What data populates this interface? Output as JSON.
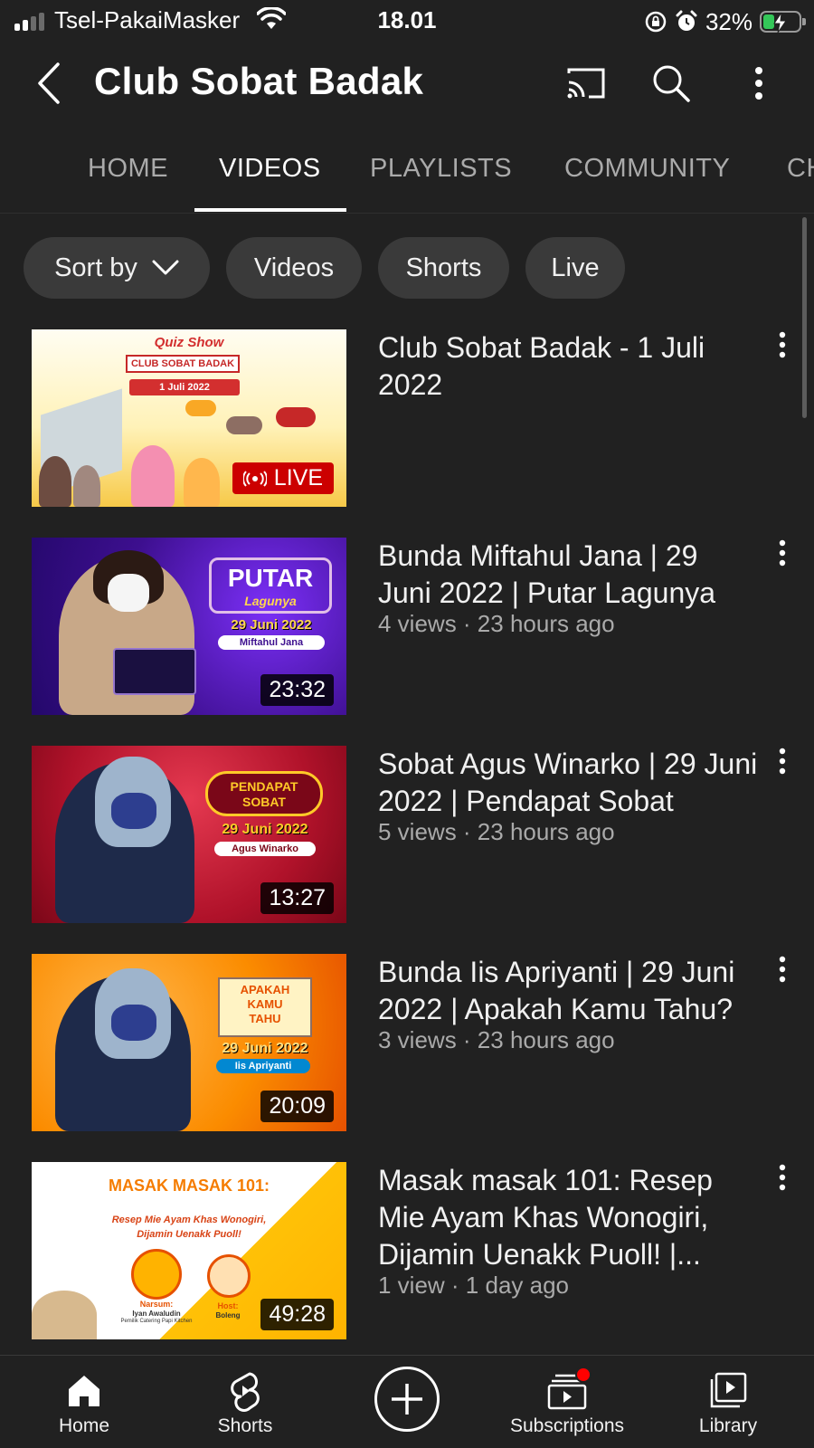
{
  "status_bar": {
    "carrier": "Tsel-PakaiMasker",
    "time": "18.01",
    "battery": "32%",
    "battery_level": 0.32
  },
  "header": {
    "title": "Club Sobat Badak",
    "icons": [
      "back-icon",
      "cast-icon",
      "search-icon",
      "more-vertical-icon"
    ]
  },
  "tabs": [
    {
      "label": "HOME",
      "active": false
    },
    {
      "label": "VIDEOS",
      "active": true
    },
    {
      "label": "PLAYLISTS",
      "active": false
    },
    {
      "label": "COMMUNITY",
      "active": false
    },
    {
      "label": "CH",
      "active": false
    }
  ],
  "chips": [
    {
      "label": "Sort by",
      "icon": "chevron-down-icon"
    },
    {
      "label": "Videos"
    },
    {
      "label": "Shorts"
    },
    {
      "label": "Live"
    }
  ],
  "videos": [
    {
      "title": "Club Sobat Badak - 1 Juli 2022",
      "subtitle": "",
      "badge": "LIVE",
      "thumb": {
        "lines": [
          "Quiz Show",
          "CLUB SOBAT BADAK",
          "1 Juli 2022"
        ],
        "theme": "yellow"
      }
    },
    {
      "title": "Bunda Miftahul Jana | 29 Juni 2022 | Putar Lagunya",
      "subtitle": "4 views · 23 hours ago",
      "duration": "23:32",
      "thumb": {
        "lines": [
          "PUTAR",
          "Lagunya",
          "29 Juni 2022",
          "Miftahul Jana"
        ],
        "theme": "purple"
      }
    },
    {
      "title": "Sobat Agus Winarko | 29 Juni 2022 | Pendapat Sobat",
      "subtitle": "5 views · 23 hours ago",
      "duration": "13:27",
      "thumb": {
        "lines": [
          "PENDAPAT",
          "SOBAT",
          "29 Juni 2022",
          "Agus Winarko"
        ],
        "theme": "red"
      }
    },
    {
      "title": "Bunda Iis Apriyanti | 29 Juni 2022 | Apakah Kamu Tahu?",
      "subtitle": "3 views · 23 hours ago",
      "duration": "20:09",
      "thumb": {
        "lines": [
          "APAKAH",
          "KAMU",
          "TAHU",
          "29 Juni 2022",
          "Iis Apriyanti"
        ],
        "theme": "orange"
      }
    },
    {
      "title": "Masak masak 101: Resep Mie Ayam Khas Wonogiri, Dijamin Uenakk Puoll! |...",
      "subtitle": "1 view · 1 day ago",
      "duration": "49:28",
      "thumb": {
        "lines": [
          "MASAK MASAK 101:",
          "Resep Mie Ayam Khas Wonogiri,",
          "Dijamin Uenakk Puoll!",
          "Narsum:",
          "Iyan Awaludin",
          "Pemilik Catering Papi Kitchen",
          "Host:",
          "Boleng"
        ],
        "theme": "white"
      }
    }
  ],
  "bottom_nav": [
    {
      "label": "Home",
      "icon": "home-icon"
    },
    {
      "label": "Shorts",
      "icon": "shorts-icon"
    },
    {
      "label": "",
      "icon": "create-icon"
    },
    {
      "label": "Subscriptions",
      "icon": "subscriptions-icon"
    },
    {
      "label": "Library",
      "icon": "library-icon"
    }
  ],
  "colors": {
    "background": "#212121",
    "chip": "#3a3a3a",
    "live": "#cc0000",
    "battery": "#34c759",
    "notification": "#ff0000"
  }
}
